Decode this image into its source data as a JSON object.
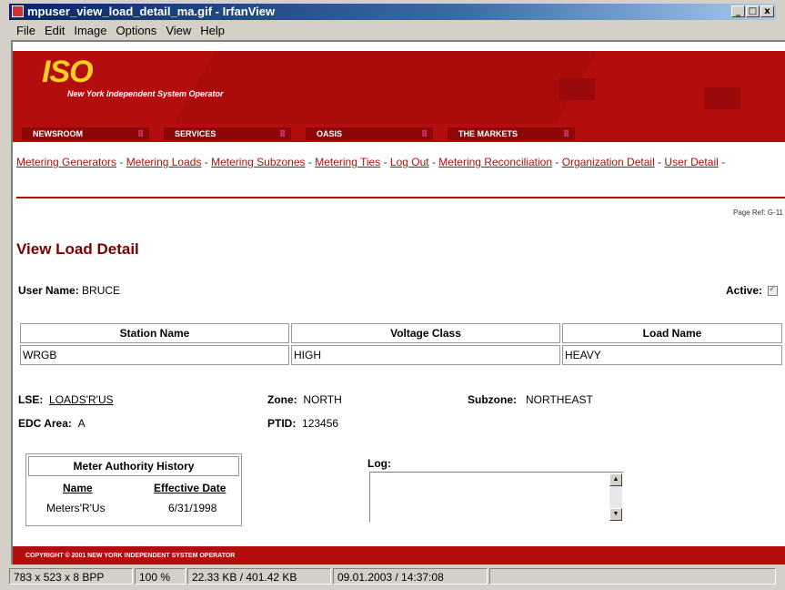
{
  "window": {
    "title": "mpuser_view_load_detail_ma.gif - IrfanView",
    "minimize": "_",
    "maximize": "□",
    "close": "x"
  },
  "menu": [
    "File",
    "Edit",
    "Image",
    "Options",
    "View",
    "Help"
  ],
  "site": {
    "logo": "ISO",
    "logo_sub": "New York Independent System Operator",
    "nav": [
      "NEWSROOM",
      "SERVICES",
      "OASIS",
      "THE MARKETS"
    ],
    "links": [
      "Metering Generators",
      "Metering Loads",
      "Metering Subzones",
      "Metering Ties",
      "Log Out",
      "Metering Reconciliation",
      "Organization Detail",
      "User Detail"
    ],
    "page_ref": "Page Ref: G-11",
    "page_title": "View Load Detail",
    "user_label": "User Name:",
    "user_value": "BRUCE",
    "active_label": "Active:",
    "table": {
      "headers": [
        "Station Name",
        "Voltage Class",
        "Load Name"
      ],
      "row": [
        "WRGB",
        "HIGH",
        "HEAVY"
      ]
    },
    "lse_label": "LSE:",
    "lse_value": "LOADS'R'US",
    "edc_label": "EDC Area:",
    "edc_value": "A",
    "zone_label": "Zone:",
    "zone_value": "NORTH",
    "ptid_label": "PTID:",
    "ptid_value": "123456",
    "subzone_label": "Subzone:",
    "subzone_value": "NORTHEAST",
    "mah": {
      "title": "Meter Authority History",
      "col1": "Name",
      "col2": "Effective Date",
      "name": "Meters'R'Us",
      "date": "6/31/1998"
    },
    "log_label": "Log:",
    "footer": "COPYRIGHT © 2001 NEW YORK INDEPENDENT SYSTEM OPERATOR"
  },
  "status": [
    "783 x 523 x 8 BPP",
    "100 %",
    "22.33 KB / 401.42 KB",
    "09.01.2003 / 14:37:08"
  ],
  "colors": {
    "brand_red": "#b30d0d",
    "logo_yellow": "#ffd21f",
    "titlebar": "#0a246a"
  }
}
